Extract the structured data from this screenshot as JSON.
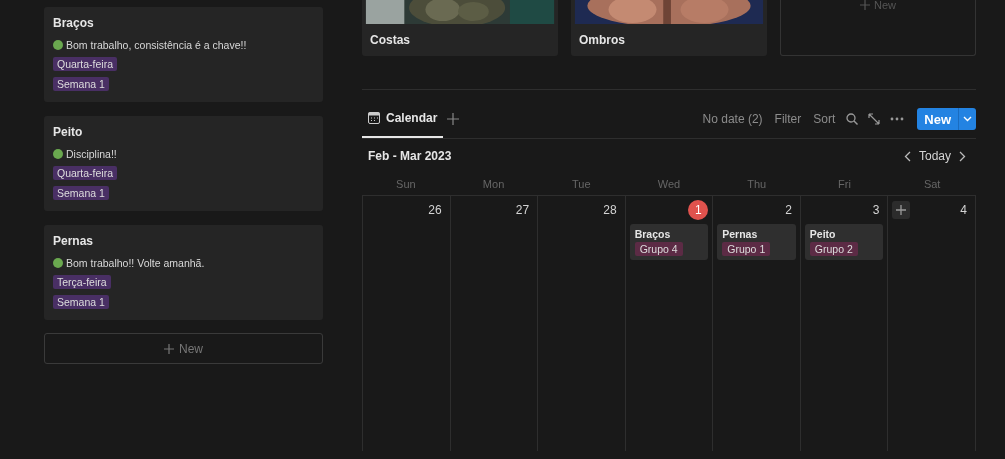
{
  "board": {
    "cards": [
      {
        "title": "Braços",
        "note": "Bom trabalho, consistência é a chave!!",
        "color": "#6aa84f",
        "tags": [
          "Quarta-feira",
          "Semana 1"
        ]
      },
      {
        "title": "Peito",
        "note": "Disciplina!!",
        "color": "#6aa84f",
        "tags": [
          "Quarta-feira",
          "Semana 1"
        ]
      },
      {
        "title": "Pernas",
        "note": "Bom trabalho!! Volte amanhã.",
        "color": "#6aa84f",
        "tags": [
          "Terça-feira",
          "Semana 1"
        ]
      }
    ],
    "new_label": "New"
  },
  "gallery": {
    "cards": [
      {
        "title": "Costas",
        "kind": "picture"
      },
      {
        "title": "Ombros",
        "kind": "picture"
      }
    ],
    "new_label": "New"
  },
  "views": {
    "tabs": [
      {
        "label": "Calendar",
        "selected": true
      }
    ],
    "actions": [
      "No date (2)",
      "Filter",
      "Sort"
    ],
    "new_button": "New"
  },
  "calendar": {
    "range": "Feb - Mar 2023",
    "today_label": "Today",
    "weekdays": [
      "Sun",
      "Mon",
      "Tue",
      "Wed",
      "Thu",
      "Fri",
      "Sat"
    ],
    "days": [
      {
        "number": "26",
        "today": false,
        "hover": false
      },
      {
        "number": "27",
        "today": false,
        "hover": false
      },
      {
        "number": "28",
        "today": false,
        "hover": false
      },
      {
        "number": "1",
        "today": true,
        "hover": false,
        "events": [
          {
            "title": "Braços",
            "tag": "Grupo 4"
          }
        ]
      },
      {
        "number": "2",
        "today": false,
        "hover": false,
        "events": [
          {
            "title": "Pernas",
            "tag": "Grupo 1"
          }
        ]
      },
      {
        "number": "3",
        "today": false,
        "hover": false,
        "events": [
          {
            "title": "Peito",
            "tag": "Grupo 2"
          }
        ]
      },
      {
        "number": "4",
        "today": false,
        "hover": true
      }
    ]
  }
}
